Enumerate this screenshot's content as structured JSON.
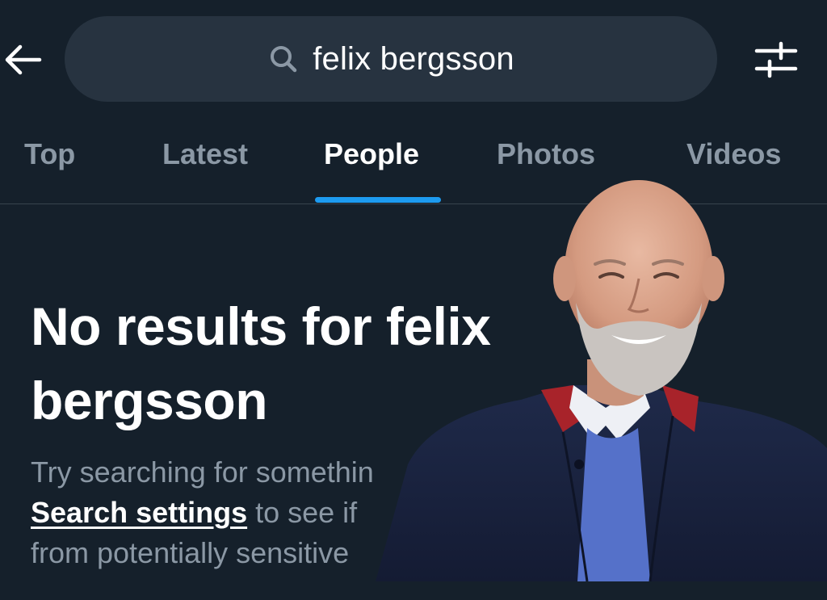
{
  "header": {
    "back_icon": "arrow-left-icon",
    "search": {
      "icon": "search-icon",
      "query": "felix bergsson"
    },
    "filter_icon": "sliders-icon"
  },
  "tabs": [
    {
      "label": "Top",
      "active": false
    },
    {
      "label": "Latest",
      "active": false
    },
    {
      "label": "People",
      "active": true
    },
    {
      "label": "Photos",
      "active": false
    },
    {
      "label": "Videos",
      "active": false
    }
  ],
  "empty_state": {
    "title_line1": "No results for felix",
    "title_line2": "bergsson",
    "body_line1": "Try searching for somethin",
    "link": "Search settings",
    "body_line2_rest": " to see if",
    "body_line3": "from potentially sensitive"
  },
  "colors": {
    "background": "#15202b",
    "search_pill": "#273340",
    "accent": "#1d9bf0",
    "muted_text": "#8b98a5"
  }
}
